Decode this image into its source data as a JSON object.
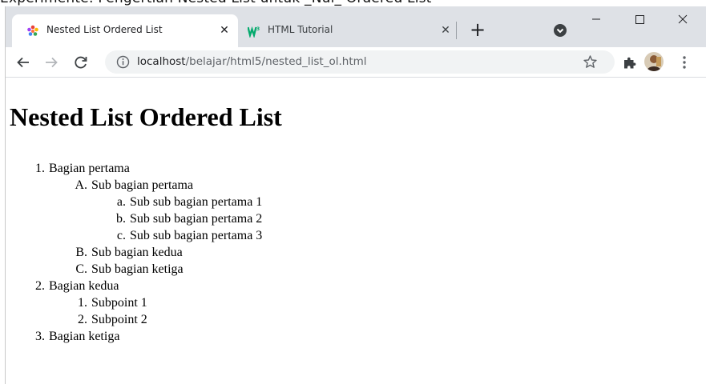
{
  "top_cut_text": "Experimente: Pengertian Nested List untuk _Nul_ Ordered List",
  "tabs": [
    {
      "title": "Nested List Ordered List",
      "active": true,
      "favicon": "colorful-flower-icon"
    },
    {
      "title": "HTML Tutorial",
      "active": false,
      "favicon": "w3schools-icon"
    }
  ],
  "window_controls": {
    "minimize": "–",
    "maximize": "☐",
    "close": "✕"
  },
  "toolbar": {
    "url_host": "localhost",
    "url_path": "/belajar/html5/nested_list_ol.html"
  },
  "page": {
    "heading": "Nested List Ordered List",
    "items": [
      {
        "marker": "1.",
        "text": "Bagian pertama",
        "level": 0
      },
      {
        "marker": "A.",
        "text": "Sub bagian pertama",
        "level": 1
      },
      {
        "marker": "a.",
        "text": "Sub sub bagian pertama 1",
        "level": 2
      },
      {
        "marker": "b.",
        "text": "Sub sub bagian pertama 2",
        "level": 2
      },
      {
        "marker": "c.",
        "text": "Sub sub bagian pertama 3",
        "level": 2
      },
      {
        "marker": "B.",
        "text": "Sub bagian kedua",
        "level": 1
      },
      {
        "marker": "C.",
        "text": "Sub bagian ketiga",
        "level": 1
      },
      {
        "marker": "2.",
        "text": "Bagian kedua",
        "level": 0
      },
      {
        "marker": "1.",
        "text": "Subpoint 1",
        "level": 1
      },
      {
        "marker": "2.",
        "text": "Subpoint 2",
        "level": 1
      },
      {
        "marker": "3.",
        "text": "Bagian ketiga",
        "level": 0
      }
    ]
  }
}
